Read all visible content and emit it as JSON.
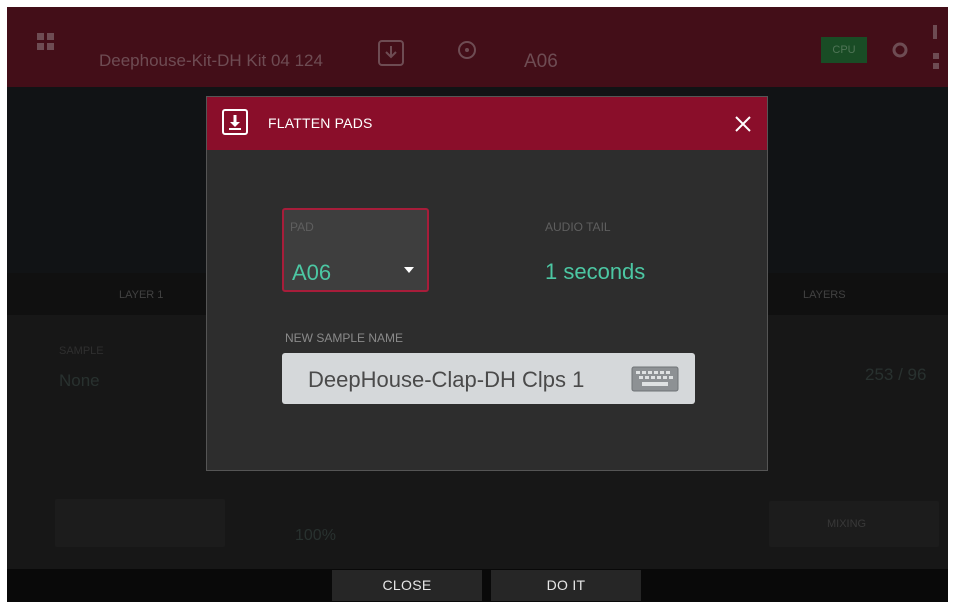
{
  "background": {
    "project_title": "Deephouse-Kit-DH Kit 04 124",
    "current_pad": "A06",
    "layer_tab": "LAYER 1",
    "layers_tab": "LAYERS",
    "sample_label": "SAMPLE",
    "sample_value": "None",
    "level_value": "100%",
    "right_value": "253 / 96",
    "right_button": "MIXING",
    "meter": "CPU"
  },
  "dialog": {
    "title": "FLATTEN PADS",
    "pad_label": "PAD",
    "pad_value": "A06",
    "audio_tail_label": "AUDIO TAIL",
    "audio_tail_value": "1 seconds",
    "new_sample_name_label": "NEW SAMPLE NAME",
    "new_sample_name_value": "DeepHouse-Clap-DH Clps 1",
    "icons": {
      "header": "flatten-download-icon",
      "close": "close-icon",
      "keyboard": "keyboard-icon",
      "dropdown": "caret-down-icon"
    }
  },
  "footer": {
    "close_label": "CLOSE",
    "do_it_label": "DO IT"
  },
  "colors": {
    "header_red": "#8a0e2a",
    "accent_teal": "#4cc7a3",
    "focus_border": "#a71d3a",
    "panel_bg": "#2d2d2d"
  }
}
